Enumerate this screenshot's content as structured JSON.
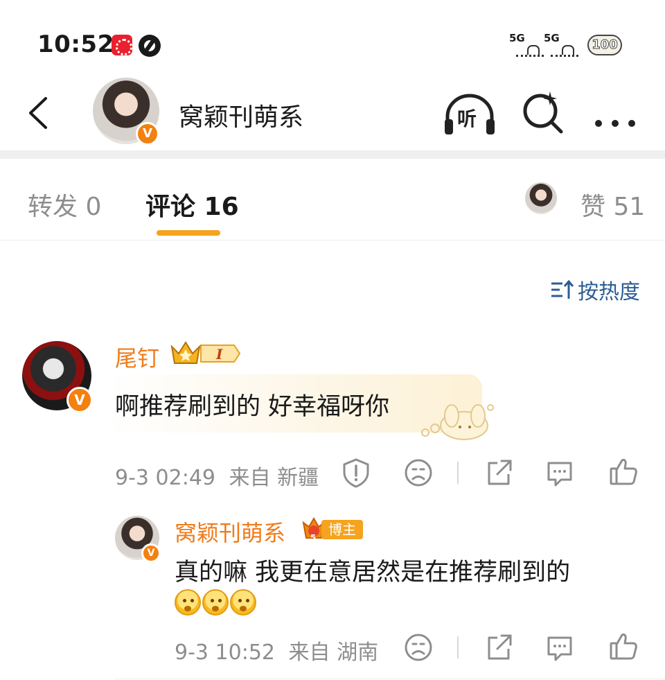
{
  "status_bar": {
    "time": "10:52",
    "signal_1": "5G",
    "signal_2": "5G",
    "battery": "100"
  },
  "header": {
    "title": "窝颖刊萌系",
    "verified_badge": "V",
    "listen_label": "听"
  },
  "tabs": {
    "repost": "转发 0",
    "comment": "评论 16",
    "like": "赞 51"
  },
  "sort": {
    "label": "按热度"
  },
  "comment": {
    "username": "尾钉",
    "level_badge": "I",
    "text": "啊推荐刷到的 好幸福呀你",
    "time": "9-3 02:49",
    "location": "来自 新疆",
    "verified_badge": "V"
  },
  "reply": {
    "username": "窝颖刊萌系",
    "role_badge": "博主",
    "role_level": "5",
    "text": "真的嘛 我更在意居然是在推荐刷到的",
    "time": "9-3 10:52",
    "location": "来自 湖南",
    "verified_badge": "V",
    "emojis": [
      "pleading-emoji",
      "pleading-emoji",
      "pleading-emoji"
    ]
  },
  "colors": {
    "accent_orange": "#ef7b1a",
    "tab_underline": "#f5a320",
    "link_blue": "#2c5c94",
    "muted_gray": "#8d8d8d"
  }
}
